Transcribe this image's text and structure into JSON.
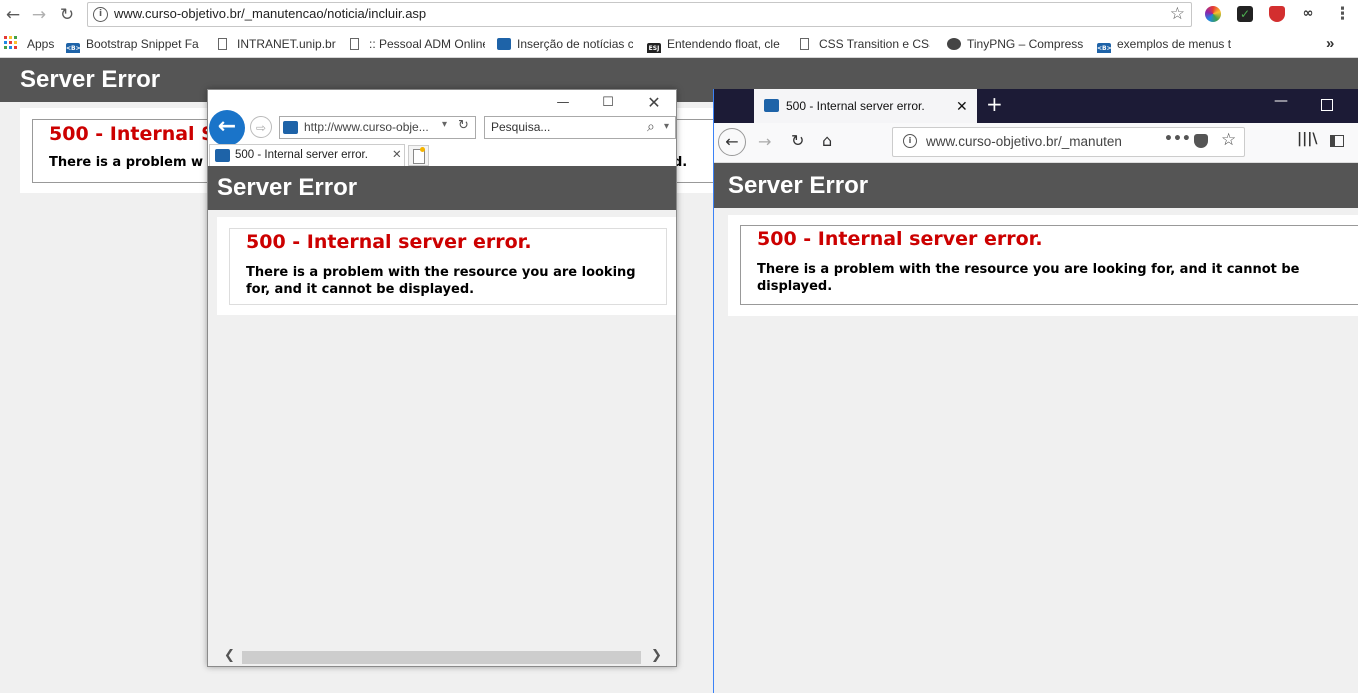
{
  "chrome": {
    "url": "www.curso-objetivo.br/_manutencao/noticia/incluir.asp",
    "nav": {
      "back": "←",
      "forward": "→",
      "reload": "↻"
    },
    "bookmarks": [
      {
        "label": "Apps"
      },
      {
        "label": "Bootstrap Snippet Fa",
        "icon_text": "<B>"
      },
      {
        "label": "INTRANET.unip.br"
      },
      {
        "label": ":: Pessoal ADM Online"
      },
      {
        "label": "Inserção de notícias c"
      },
      {
        "label": "Entendendo float, cle",
        "icon_text": "ESJ"
      },
      {
        "label": "CSS Transition e CSS"
      },
      {
        "label": "TinyPNG – Compress"
      },
      {
        "label": "exemplos de menus t",
        "icon_text": "<B>"
      }
    ],
    "more_bookmarks": "»",
    "menu": "⋮",
    "page": {
      "header": "Server Error",
      "error_title_visible": "500 - Internal S",
      "error_msg_visible": "There is a problem w",
      "error_msg_tail": "d."
    }
  },
  "ie": {
    "url": "http://www.curso-obje...",
    "search_placeholder": "Pesquisa...",
    "tab_title": "500 - Internal server error.",
    "page": {
      "header": "Server Error",
      "error_title": "500 - Internal server error.",
      "error_msg": "There is a problem with the resource you are looking for, and it cannot be displayed."
    }
  },
  "firefox": {
    "tab_title": "500 - Internal server error.",
    "url": "www.curso-objetivo.br/_manuten",
    "page": {
      "header": "Server Error",
      "error_title": "500 - Internal server error.",
      "error_msg": "There is a problem with the resource you are looking for, and it cannot be displayed."
    }
  },
  "colors": {
    "error_red": "#cc0000",
    "header_bg": "#555555",
    "ff_titlebar": "#1c1b36",
    "ie_blue": "#1a74c9"
  }
}
